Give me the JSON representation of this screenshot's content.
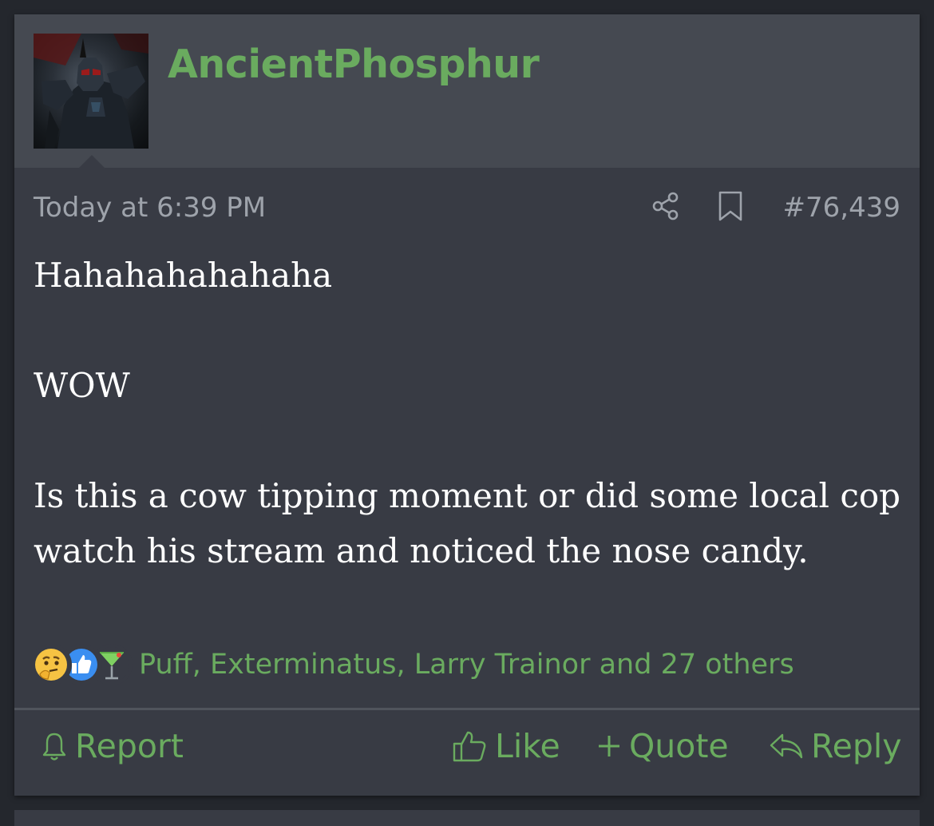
{
  "post": {
    "username": "AncientPhosphur",
    "timestamp": "Today at 6:39 PM",
    "post_number": "#76,439",
    "body": {
      "line1": "Hahahahahahaha",
      "line2": "WOW",
      "line3": "Is this a cow tipping moment or did some local cop watch his stream and noticed the nose candy."
    },
    "reactions": {
      "icons": [
        "thinking-emoji",
        "like-thumb",
        "cocktail-glass"
      ],
      "names": "Puff, Exterminatus, Larry Trainor and 27 others"
    },
    "actions": {
      "report": "Report",
      "like": "Like",
      "quote": "Quote",
      "reply": "Reply"
    }
  },
  "colors": {
    "accent_green": "#6aab5f",
    "header_bg": "#454951",
    "post_bg": "#383b44",
    "page_bg": "#24272d",
    "meta_text": "#9ea3ab"
  }
}
